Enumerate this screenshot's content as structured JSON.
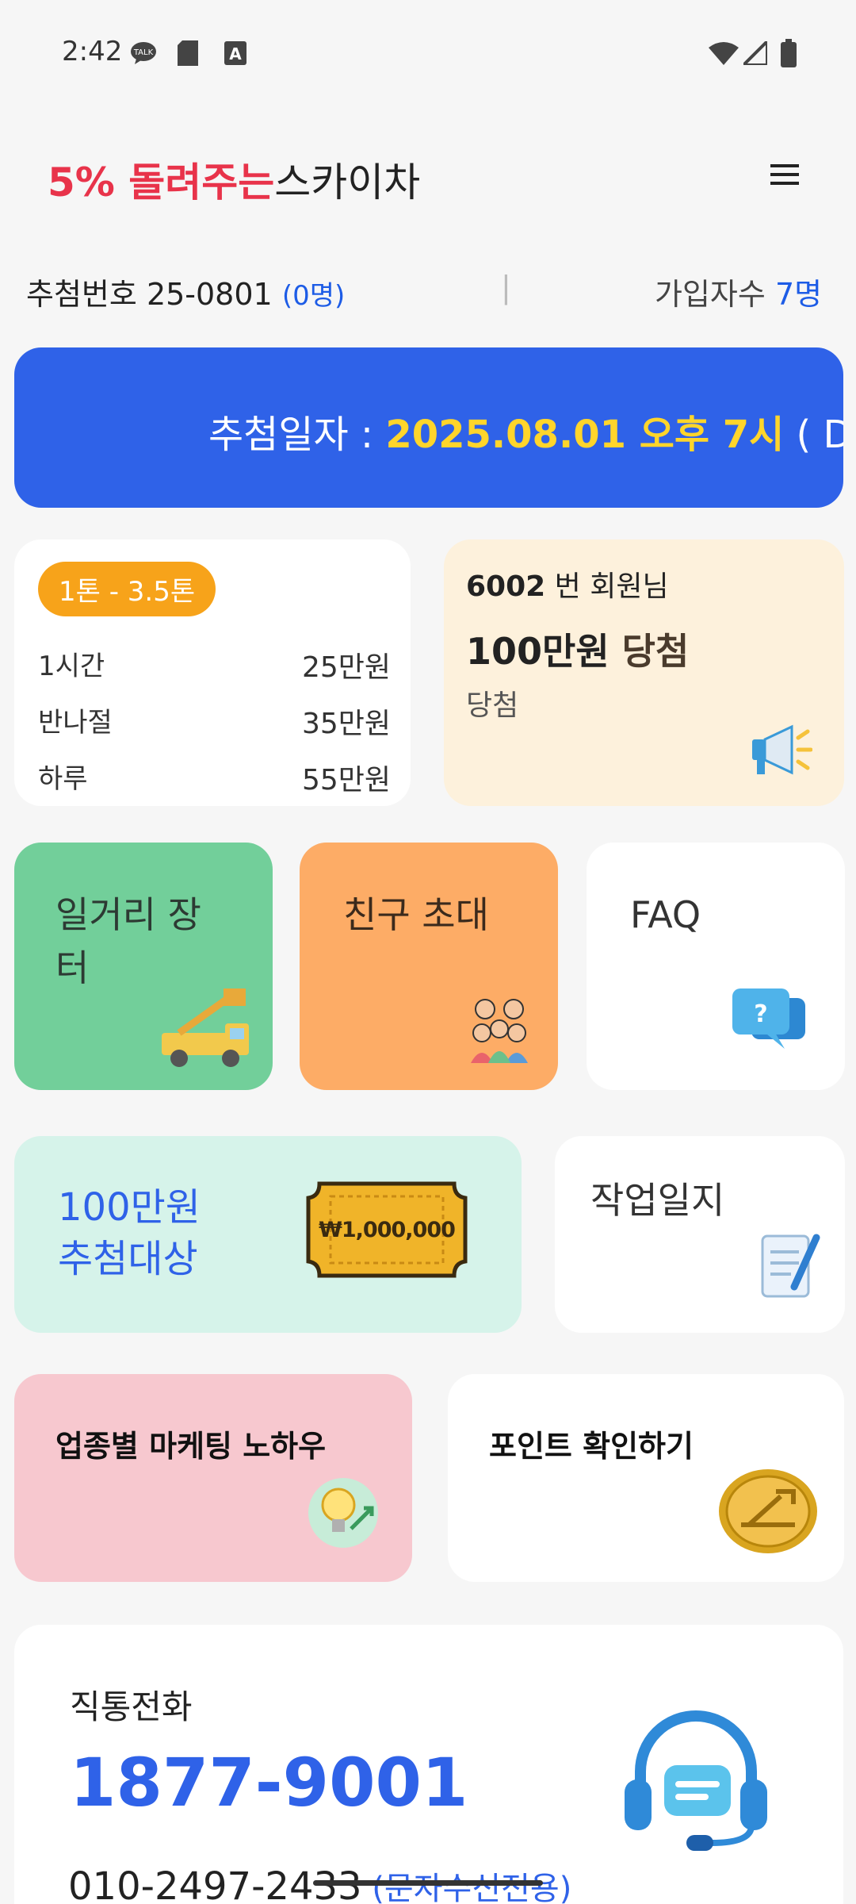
{
  "status_bar": {
    "time": "2:42",
    "icons": [
      "talk-bubble-icon",
      "sd-card-icon",
      "font-a-icon"
    ],
    "right_icons": [
      "wifi-icon",
      "signal-icon",
      "battery-icon"
    ]
  },
  "header": {
    "title_accent": "5% 돌려주는",
    "title_rest": "스카이차",
    "menu_icon": "hamburger-menu-icon"
  },
  "info": {
    "draw_label": "추첨번호",
    "draw_number": "25-0801",
    "draw_count": "(0명)",
    "divider": "|",
    "members_label": "가입자수",
    "members_count": "7명"
  },
  "banner": {
    "label": "추첨일자 : ",
    "date": "2025.08.01 오후 7시",
    "rest": " ( D"
  },
  "price_card": {
    "badge": "1톤 - 3.5톤",
    "rows": [
      {
        "label": "1시간",
        "value": "25만원"
      },
      {
        "label": "반나절",
        "value": "35만원"
      },
      {
        "label": "하루",
        "value": "55만원"
      }
    ]
  },
  "winner": {
    "member_no": "6002",
    "member_suffix": " 번 회원님",
    "amount": "100만원",
    "amount_suffix": " 당첨",
    "status": "당첨",
    "icon": "megaphone-icon"
  },
  "tiles": {
    "job": {
      "title_line1": "일거리 장",
      "title_line2": "터",
      "icon": "sky-truck-icon"
    },
    "friend": {
      "title": "친구 초대",
      "icon": "people-group-icon"
    },
    "faq": {
      "title": "FAQ",
      "icon": "chat-question-icon"
    },
    "lottery": {
      "line1": "100만원",
      "line2": "추첨대상",
      "ticket": "₩1,000,000"
    },
    "worklog": {
      "title": "작업일지",
      "icon": "notepad-icon"
    },
    "marketing": {
      "title": "업종별 마케팅 노하우",
      "icon": "lightbulb-icon"
    },
    "points": {
      "title": "포인트 확인하기",
      "icon": "gold-coin-icon"
    }
  },
  "call": {
    "label": "직통전화",
    "main_number": "1877-9001",
    "sub_number": "010-2497-2433",
    "sub_note": " (문자수신전용)",
    "icon": "headset-icon"
  },
  "colors": {
    "accent_red": "#e8334a",
    "primary_blue": "#2f62e8",
    "banner_yellow": "#ffd52b"
  }
}
